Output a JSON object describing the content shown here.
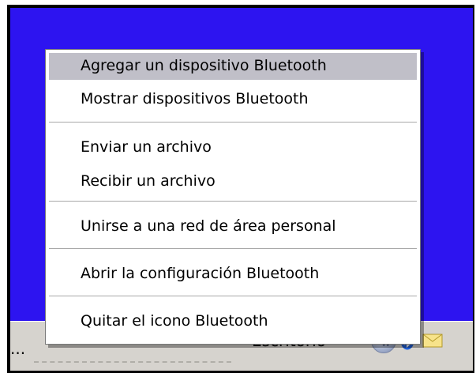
{
  "menu": {
    "items": [
      {
        "label": "Agregar un dispositivo Bluetooth",
        "highlighted": true
      },
      {
        "label": "Mostrar dispositivos Bluetooth"
      },
      {
        "label": "Enviar un archivo"
      },
      {
        "label": "Recibir un archivo"
      },
      {
        "label": "Unirse a una red de área personal"
      },
      {
        "label": "Abrir la configuración Bluetooth"
      },
      {
        "label": "Quitar el icono Bluetooth"
      }
    ]
  },
  "taskbar": {
    "overflow_text": "...",
    "toolbar_label": "Escritorio",
    "chevron": "»",
    "tray_icons": [
      "show-hidden-icons-icon",
      "bluetooth-icon",
      "mail-icon"
    ]
  },
  "colors": {
    "desktop": "#2d14f0",
    "menu_highlight": "#c0bfc8",
    "taskbar": "#d6d3ce"
  }
}
